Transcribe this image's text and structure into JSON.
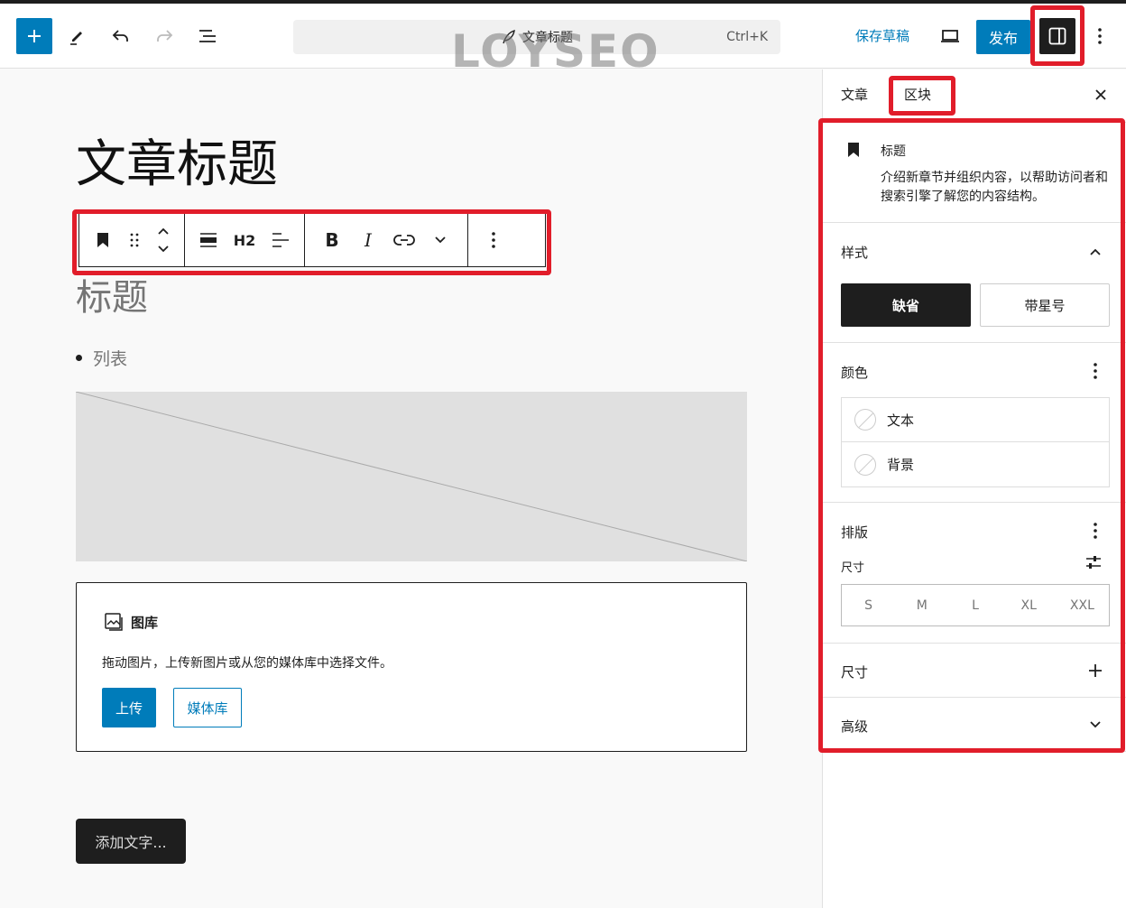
{
  "topbar": {
    "command_title": "文章标题",
    "command_shortcut": "Ctrl+K",
    "watermark": "LOYSEO",
    "save_draft": "保存草稿",
    "publish": "发布"
  },
  "editor": {
    "post_title": "文章标题",
    "toolbar": {
      "heading_level": "H2",
      "bold": "B",
      "italic": "I"
    },
    "heading_placeholder": "标题",
    "list_placeholder": "列表",
    "gallery": {
      "title": "图库",
      "description": "拖动图片，上传新图片或从您的媒体库中选择文件。",
      "upload": "上传",
      "media_library": "媒体库"
    },
    "add_text": "添加文字..."
  },
  "sidebar": {
    "tabs": [
      {
        "label": "文章",
        "active": false
      },
      {
        "label": "区块",
        "active": true
      }
    ],
    "block_card": {
      "title": "标题",
      "description": "介绍新章节并组织内容，以帮助访问者和搜索引擎了解您的内容结构。"
    },
    "styles": {
      "title": "样式",
      "options": [
        "缺省",
        "带星号"
      ],
      "selected": "缺省"
    },
    "color": {
      "title": "颜色",
      "items": [
        "文本",
        "背景"
      ]
    },
    "typography": {
      "title": "排版",
      "size_label": "尺寸",
      "sizes": [
        "S",
        "M",
        "L",
        "XL",
        "XXL"
      ]
    },
    "dimensions": {
      "title": "尺寸"
    },
    "advanced": {
      "title": "高级"
    }
  },
  "colors": {
    "accent": "#007cba",
    "highlight": "#e11d2a",
    "dark": "#1e1e1e"
  }
}
